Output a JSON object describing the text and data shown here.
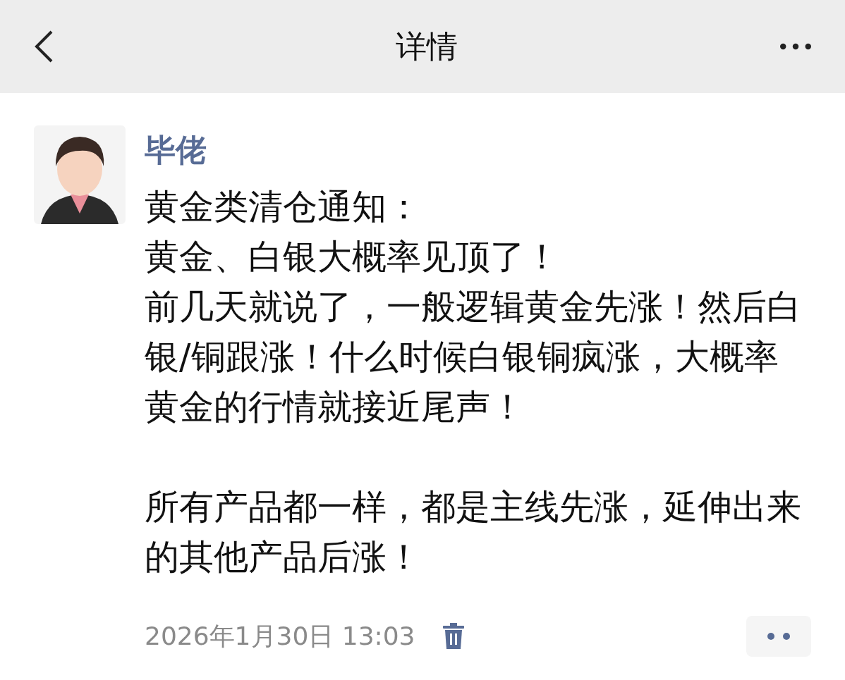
{
  "header": {
    "title": "详情"
  },
  "post": {
    "author": "毕佬",
    "blocks": [
      {
        "paragraphs": [
          "黄金类清仓通知：",
          "黄金、白银大概率见顶了！",
          "前几天就说了，一般逻辑黄金先涨！然后白银/铜跟涨！什么时候白银铜疯涨，大概率黄金的行情就接近尾声！"
        ]
      },
      {
        "paragraphs": [
          "所有产品都一样，都是主线先涨，延伸出来的其他产品后涨！"
        ]
      }
    ],
    "time": "2026年1月30日 13:03"
  }
}
